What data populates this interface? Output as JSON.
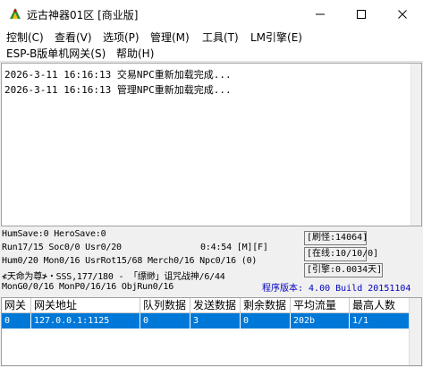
{
  "window": {
    "title": "远古神器01区 [商业版]",
    "min_icon": "minimize-icon",
    "max_icon": "maximize-icon",
    "close_icon": "close-icon"
  },
  "menu": {
    "items": [
      "控制(C)",
      "查看(V)",
      "选项(P)",
      "管理(M)",
      "工具(T)",
      "LM引擎(E)",
      "ESP-B版单机网关(S)",
      "帮助(H)"
    ]
  },
  "log": {
    "lines": [
      "2026-3-11 16:16:13 交易NPC重新加载完成...",
      "2026-3-11 16:16:13 管理NPC重新加载完成..."
    ]
  },
  "stats": {
    "line1": "HumSave:0 HeroSave:0",
    "line2": "Run17/15 Soc0/0 Usr0/20",
    "time": "0:4:54 [M][F]",
    "line3": "Hum0/20 Mon0/16 UsrRot15/68 Merch0/16 Npc0/16 (0)",
    "line4": "≮天命为尊≯・SSS,177/180 - 「缥缈」诅咒战神/6/44",
    "line5": "MonG0/0/16 MonP0/16/16 ObjRun0/16",
    "box1": "[刷怪:14064]",
    "box2": "[在线:10/10/0]",
    "box3": "[引擎:0.0034天]",
    "version": "程序版本: 4.00 Build 20151104"
  },
  "grid": {
    "headers": [
      "网关",
      "网关地址",
      "队列数据",
      "发送数据",
      "剩余数据",
      "平均流量",
      "最高人数"
    ],
    "row": [
      "0",
      "127.0.0.1:1125",
      "0",
      "3",
      "0",
      "202b",
      "1/1"
    ]
  },
  "colors": {
    "selection": "#0078d7",
    "version_text": "#0000c0"
  }
}
